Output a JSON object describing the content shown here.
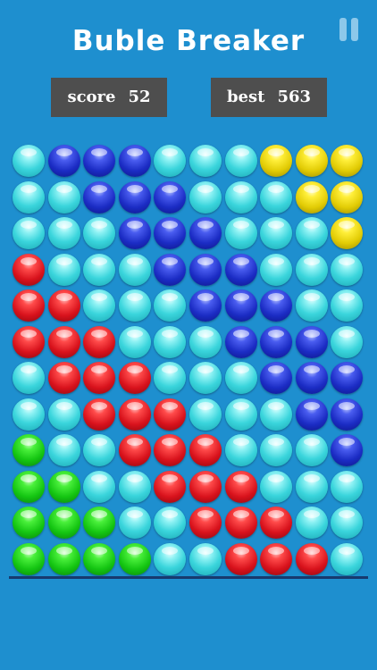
{
  "game": {
    "title": "Buble Breaker"
  },
  "hud": {
    "score_label": "score",
    "score_value": "52",
    "best_label": "best",
    "best_value": "563"
  },
  "icons": {
    "pause": "pause-icon"
  },
  "colors": {
    "background": "#1e8fcf",
    "score_box": "#4e4e4e",
    "baseline": "#173a6e",
    "cyan": "#3ad5dc",
    "blue": "#1b2cc4",
    "red": "#d8121c",
    "green": "#14c512",
    "yellow": "#e2cc05"
  },
  "board": {
    "columns": 10,
    "rows": [
      [
        "cyan",
        "blue",
        "blue",
        "blue",
        "cyan",
        "cyan",
        "cyan",
        "yellow",
        "yellow",
        "yellow"
      ],
      [
        "cyan",
        "cyan",
        "blue",
        "blue",
        "blue",
        "cyan",
        "cyan",
        "cyan",
        "yellow",
        "yellow"
      ],
      [
        "cyan",
        "cyan",
        "cyan",
        "blue",
        "blue",
        "blue",
        "cyan",
        "cyan",
        "cyan",
        "yellow"
      ],
      [
        "red",
        "cyan",
        "cyan",
        "cyan",
        "blue",
        "blue",
        "blue",
        "cyan",
        "cyan",
        "cyan"
      ],
      [
        "red",
        "red",
        "cyan",
        "cyan",
        "cyan",
        "blue",
        "blue",
        "blue",
        "cyan",
        "cyan"
      ],
      [
        "red",
        "red",
        "red",
        "cyan",
        "cyan",
        "cyan",
        "blue",
        "blue",
        "blue",
        "cyan"
      ],
      [
        "cyan",
        "red",
        "red",
        "red",
        "cyan",
        "cyan",
        "cyan",
        "blue",
        "blue",
        "blue"
      ],
      [
        "cyan",
        "cyan",
        "red",
        "red",
        "red",
        "cyan",
        "cyan",
        "cyan",
        "blue",
        "blue"
      ],
      [
        "green",
        "cyan",
        "cyan",
        "red",
        "red",
        "red",
        "cyan",
        "cyan",
        "cyan",
        "blue"
      ],
      [
        "green",
        "green",
        "cyan",
        "cyan",
        "red",
        "red",
        "red",
        "cyan",
        "cyan",
        "cyan"
      ],
      [
        "green",
        "green",
        "green",
        "cyan",
        "cyan",
        "red",
        "red",
        "red",
        "cyan",
        "cyan"
      ],
      [
        "green",
        "green",
        "green",
        "green",
        "cyan",
        "cyan",
        "red",
        "red",
        "red",
        "cyan"
      ]
    ]
  }
}
